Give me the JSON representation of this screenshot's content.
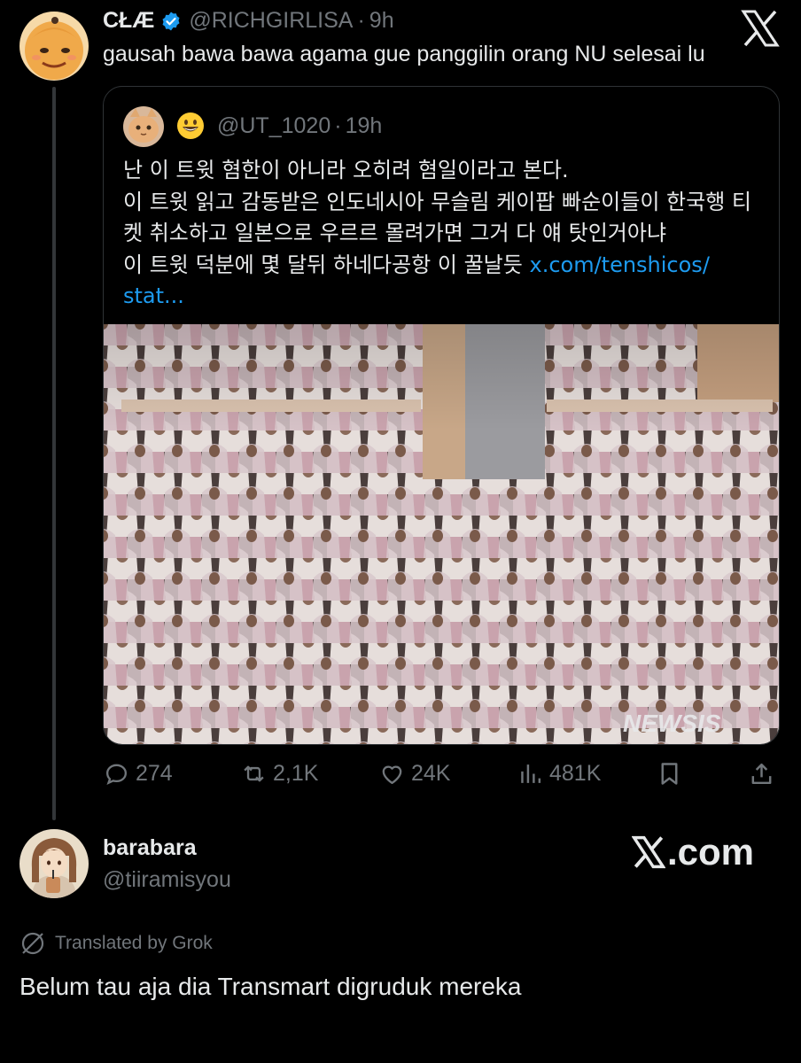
{
  "tweet": {
    "display_name": "CŁÆ",
    "handle": "@RICHGIRLISA",
    "separator": "·",
    "time": "9h",
    "text": "gausah bawa bawa agama gue panggilin orang NU selesai lu",
    "quote": {
      "handle": "@UT_1020",
      "separator": "·",
      "time": "19h",
      "lines": [
        "난 이 트윗 혐한이 아니라 오히려 혐일이라고 본다.",
        "이 트윗 읽고 감동받은 인도네시아 무슬림 케이팝 빠순이들이 한국행 티",
        "켓 취소하고 일본으로 우르르 몰려가면 그거 다 얘 탓인거아냐",
        "이 트윗 덕분에 몇 달뒤 하네다공항 이 꿀날듯"
      ],
      "link_part1": "x.com/tenshicos/",
      "link_part2": "stat...",
      "image_watermark": "NEWSIS"
    },
    "stats": {
      "replies": "274",
      "reposts": "2,1K",
      "likes": "24K",
      "views": "481K"
    }
  },
  "reply": {
    "display_name": "barabara",
    "handle": "@tiiramisyou",
    "translated_label": "Translated by Grok",
    "text": "Belum tau aja dia Transmart digruduk mereka"
  },
  "watermark": ".com",
  "colors": {
    "background": "#000000",
    "text_primary": "#e7e9ea",
    "text_secondary": "#71767b",
    "link": "#1d9bf0",
    "verified": "#1d9bf0",
    "border": "#2f3336"
  },
  "icons": [
    "x-logo-icon",
    "verified-badge-icon",
    "grinning-emoji-icon",
    "reply-icon",
    "repost-icon",
    "like-icon",
    "views-icon",
    "bookmark-icon",
    "share-icon",
    "translate-icon"
  ]
}
